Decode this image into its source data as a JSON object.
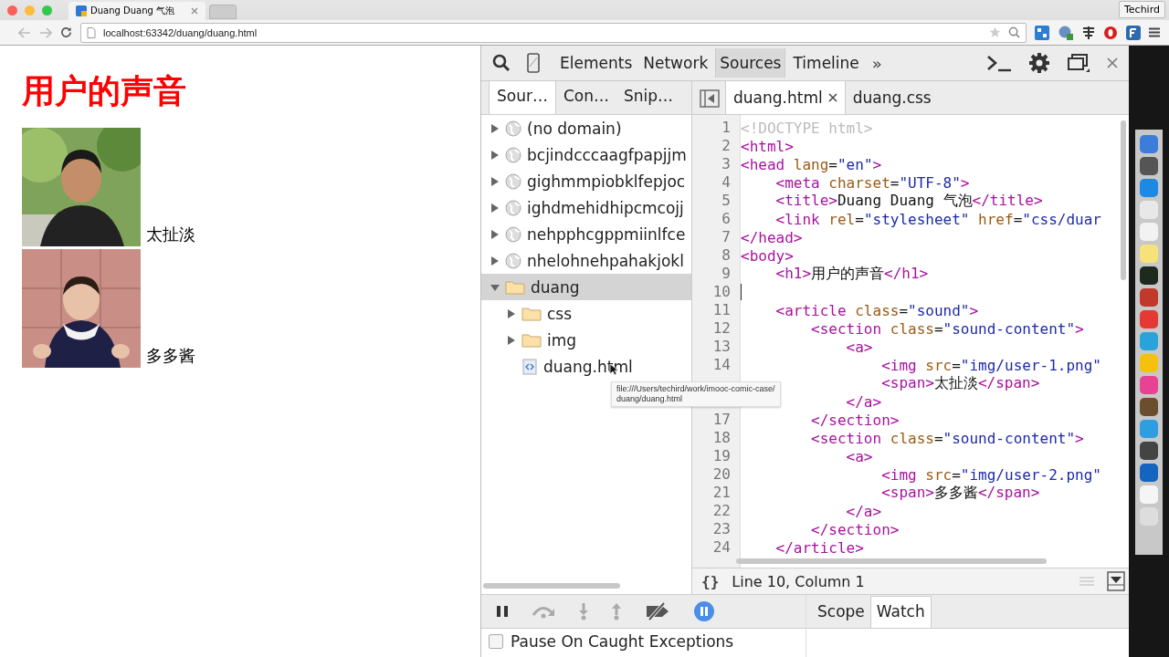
{
  "browser": {
    "tabs": [
      {
        "title": "Duang Duang 气泡",
        "selected": true
      }
    ],
    "profile": "Techird",
    "address": "localhost:63342/duang/duang.html"
  },
  "page": {
    "heading": "用户的声音",
    "users": [
      {
        "name": "太扯淡",
        "kind": "picture"
      },
      {
        "name": "多多酱",
        "kind": "picture"
      }
    ]
  },
  "devtools": {
    "panels": [
      {
        "label": "Elements",
        "selected": false
      },
      {
        "label": "Network",
        "selected": false
      },
      {
        "label": "Sources",
        "selected": true
      },
      {
        "label": "Timeline",
        "selected": false
      }
    ],
    "more": "»",
    "navigator_tabs": [
      {
        "label": "Sour…",
        "selected": true
      },
      {
        "label": "Con…",
        "selected": false
      },
      {
        "label": "Snip…",
        "selected": false
      }
    ],
    "tree": [
      {
        "label": "(no domain)",
        "kind": "domain",
        "expanded": false,
        "selected": false
      },
      {
        "label": "bcjindcccaagfpapjjm",
        "kind": "domain",
        "expanded": false,
        "selected": false
      },
      {
        "label": "gighmmpiobklfepjoc",
        "kind": "domain",
        "expanded": false,
        "selected": false
      },
      {
        "label": "ighdmehidhipcmcojj",
        "kind": "domain",
        "expanded": false,
        "selected": false
      },
      {
        "label": "nehpphcgppmiinlfce",
        "kind": "domain",
        "expanded": false,
        "selected": false
      },
      {
        "label": "nhelohnehpahakjokl",
        "kind": "domain",
        "expanded": false,
        "selected": false
      },
      {
        "label": "duang",
        "kind": "folder",
        "expanded": true,
        "selected": true,
        "children": [
          {
            "label": "css",
            "kind": "folder",
            "expanded": false,
            "selected": false
          },
          {
            "label": "img",
            "kind": "folder",
            "expanded": false,
            "selected": false
          },
          {
            "label": "duang.html",
            "kind": "file",
            "selected": false
          }
        ]
      }
    ],
    "tooltip": [
      "file:///Users/techird/work/imooc-comic-case/",
      "duang/duang.html"
    ],
    "editor_tabs": [
      {
        "label": "duang.html",
        "selected": true,
        "closable": true
      },
      {
        "label": "duang.css",
        "selected": false,
        "closable": false
      }
    ],
    "code": [
      {
        "number": "1",
        "caret": false,
        "tokens": [
          {
            "kind": "comment",
            "t": "<!DOCTYPE html>"
          }
        ]
      },
      {
        "number": "2",
        "caret": false,
        "tokens": [
          {
            "kind": "tag",
            "t": "<html>"
          }
        ]
      },
      {
        "number": "3",
        "caret": false,
        "tokens": [
          {
            "kind": "tag",
            "t": "<head"
          },
          {
            "kind": "attr",
            "t": " lang"
          },
          {
            "kind": "text",
            "t": "="
          },
          {
            "kind": "str",
            "t": "\"en\""
          },
          {
            "kind": "tag",
            "t": ">"
          }
        ]
      },
      {
        "number": "4",
        "caret": false,
        "tokens": [
          {
            "kind": "tag",
            "t": "    <meta"
          },
          {
            "kind": "attr",
            "t": " charset"
          },
          {
            "kind": "text",
            "t": "="
          },
          {
            "kind": "str",
            "t": "\"UTF-8\""
          },
          {
            "kind": "tag",
            "t": ">"
          }
        ]
      },
      {
        "number": "5",
        "caret": false,
        "tokens": [
          {
            "kind": "tag",
            "t": "    <title>"
          },
          {
            "kind": "text",
            "t": "Duang Duang 气泡"
          },
          {
            "kind": "tag",
            "t": "</title>"
          }
        ]
      },
      {
        "number": "6",
        "caret": false,
        "tokens": [
          {
            "kind": "tag",
            "t": "    <link"
          },
          {
            "kind": "attr",
            "t": " rel"
          },
          {
            "kind": "text",
            "t": "="
          },
          {
            "kind": "str",
            "t": "\"stylesheet\""
          },
          {
            "kind": "attr",
            "t": " href"
          },
          {
            "kind": "text",
            "t": "="
          },
          {
            "kind": "str",
            "t": "\"css/duar"
          }
        ]
      },
      {
        "number": "7",
        "caret": false,
        "tokens": [
          {
            "kind": "tag",
            "t": "</head>"
          }
        ]
      },
      {
        "number": "8",
        "caret": false,
        "tokens": [
          {
            "kind": "tag",
            "t": "<body>"
          }
        ]
      },
      {
        "number": "9",
        "caret": false,
        "tokens": [
          {
            "kind": "tag",
            "t": "    <h1>"
          },
          {
            "kind": "text",
            "t": "用户的声音"
          },
          {
            "kind": "tag",
            "t": "</h1>"
          }
        ]
      },
      {
        "number": "10",
        "caret": true
      },
      {
        "number": "11",
        "caret": false,
        "tokens": [
          {
            "kind": "tag",
            "t": "    <article"
          },
          {
            "kind": "attr",
            "t": " class"
          },
          {
            "kind": "text",
            "t": "="
          },
          {
            "kind": "str",
            "t": "\"sound\""
          },
          {
            "kind": "tag",
            "t": ">"
          }
        ]
      },
      {
        "number": "12",
        "caret": false,
        "tokens": [
          {
            "kind": "tag",
            "t": "        <section"
          },
          {
            "kind": "attr",
            "t": " class"
          },
          {
            "kind": "text",
            "t": "="
          },
          {
            "kind": "str",
            "t": "\"sound-content\""
          },
          {
            "kind": "tag",
            "t": ">"
          }
        ]
      },
      {
        "number": "13",
        "caret": false,
        "tokens": [
          {
            "kind": "tag",
            "t": "            <a>"
          }
        ]
      },
      {
        "number": "14",
        "caret": false,
        "tokens": [
          {
            "kind": "tag",
            "t": "                <img"
          },
          {
            "kind": "attr",
            "t": " src"
          },
          {
            "kind": "text",
            "t": "="
          },
          {
            "kind": "str",
            "t": "\"img/user-1.png\""
          }
        ]
      },
      {
        "caret": false,
        "tokens": [
          {
            "kind": "tag",
            "t": "                <span>"
          },
          {
            "kind": "text",
            "t": "太扯淡"
          },
          {
            "kind": "tag",
            "t": "</span>"
          }
        ]
      },
      {
        "caret": false,
        "tokens": [
          {
            "kind": "tag",
            "t": "            </a>"
          }
        ]
      },
      {
        "number": "17",
        "caret": false,
        "tokens": [
          {
            "kind": "tag",
            "t": "        </section>"
          }
        ]
      },
      {
        "number": "18",
        "caret": false,
        "tokens": [
          {
            "kind": "tag",
            "t": "        <section"
          },
          {
            "kind": "attr",
            "t": " class"
          },
          {
            "kind": "text",
            "t": "="
          },
          {
            "kind": "str",
            "t": "\"sound-content\""
          },
          {
            "kind": "tag",
            "t": ">"
          }
        ]
      },
      {
        "number": "19",
        "caret": false,
        "tokens": [
          {
            "kind": "tag",
            "t": "            <a>"
          }
        ]
      },
      {
        "number": "20",
        "caret": false,
        "tokens": [
          {
            "kind": "tag",
            "t": "                <img"
          },
          {
            "kind": "attr",
            "t": " src"
          },
          {
            "kind": "text",
            "t": "="
          },
          {
            "kind": "str",
            "t": "\"img/user-2.png\""
          }
        ]
      },
      {
        "number": "21",
        "caret": false,
        "tokens": [
          {
            "kind": "tag",
            "t": "                <span>"
          },
          {
            "kind": "text",
            "t": "多多酱"
          },
          {
            "kind": "tag",
            "t": "</span>"
          }
        ]
      },
      {
        "number": "22",
        "caret": false,
        "tokens": [
          {
            "kind": "tag",
            "t": "            </a>"
          }
        ]
      },
      {
        "number": "23",
        "caret": false,
        "tokens": [
          {
            "kind": "tag",
            "t": "        </section>"
          }
        ]
      },
      {
        "number": "24",
        "caret": false,
        "tokens": [
          {
            "kind": "tag",
            "t": "    </article>"
          }
        ]
      }
    ],
    "pretty_print": "{}",
    "status": "Line 10, Column 1",
    "pause_on_exceptions": {
      "label": "Pause On Caught Exceptions",
      "checked": false
    },
    "pause_on_exceptions_active": true,
    "sidebar_tabs": [
      {
        "label": "Scope",
        "selected": false
      },
      {
        "label": "Watch",
        "selected": true
      }
    ]
  }
}
